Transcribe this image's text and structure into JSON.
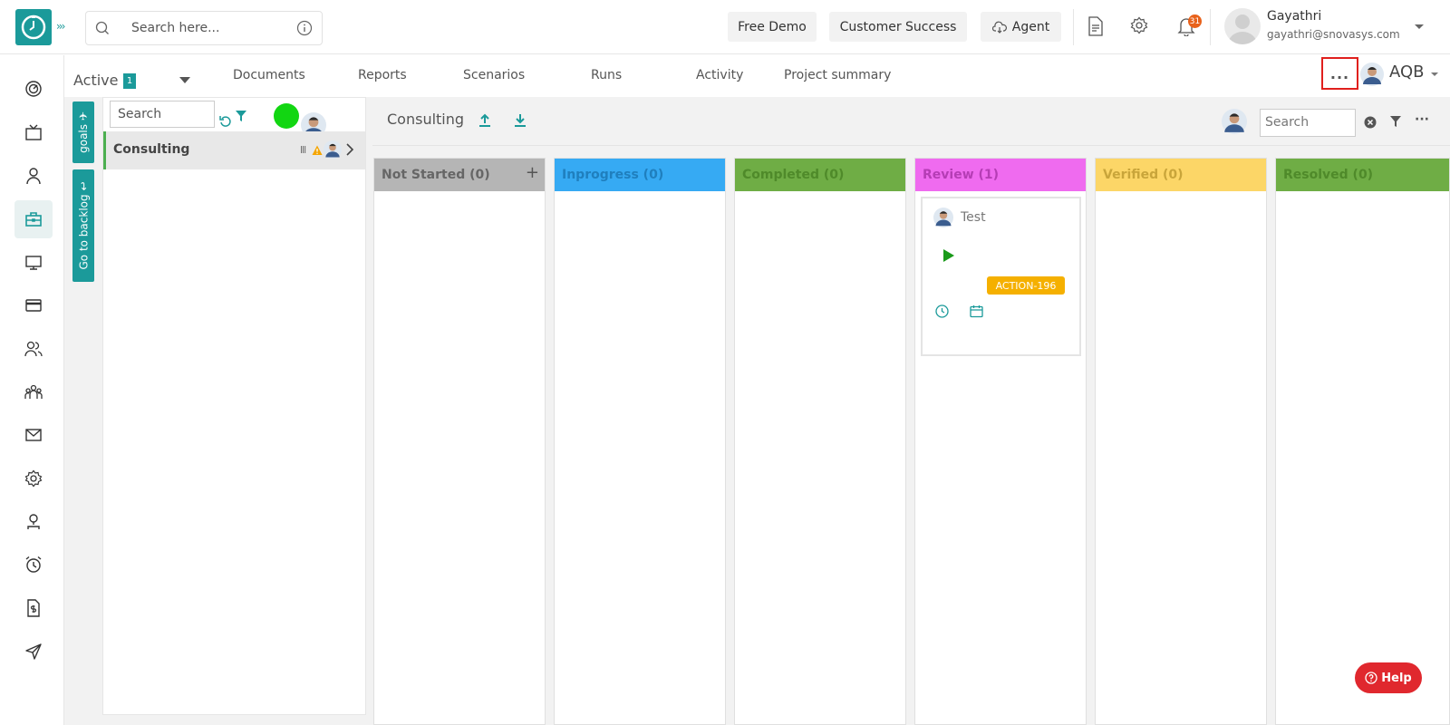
{
  "header": {
    "search_placeholder": "Search here...",
    "buttons": {
      "free_demo": "Free Demo",
      "customer_success": "Customer Success",
      "agent": "Agent"
    },
    "notification_count": "31",
    "user": {
      "name": "Gayathri",
      "email": "gayathri@snovasys.com"
    }
  },
  "sidebar": {
    "items": [
      {
        "icon": "dashboard-icon"
      },
      {
        "icon": "tv-icon"
      },
      {
        "icon": "user-icon"
      },
      {
        "icon": "briefcase-icon",
        "active": true
      },
      {
        "icon": "monitor-icon"
      },
      {
        "icon": "card-icon"
      },
      {
        "icon": "users-icon"
      },
      {
        "icon": "team-icon"
      },
      {
        "icon": "mail-icon"
      },
      {
        "icon": "settings-icon"
      },
      {
        "icon": "profile-icon"
      },
      {
        "icon": "alarm-icon"
      },
      {
        "icon": "invoice-icon"
      },
      {
        "icon": "send-icon"
      }
    ]
  },
  "subnav": {
    "status_label": "Active",
    "status_count": "1",
    "tabs": [
      "Documents",
      "Reports",
      "Scenarios",
      "Runs",
      "Activity",
      "Project summary"
    ],
    "more_label": "...",
    "project_code": "AQB"
  },
  "side_tabs": {
    "goals": "goals",
    "backlog": "Go to backlog"
  },
  "goals": {
    "search_placeholder": "Search",
    "items": [
      {
        "name": "Consulting"
      }
    ]
  },
  "board": {
    "title": "Consulting",
    "search_placeholder": "Search",
    "columns": [
      {
        "name": "Not Started (0)",
        "color": "#b5b5b5"
      },
      {
        "name": "Inprogress (0)",
        "color": "#36aaf3"
      },
      {
        "name": "Completed (0)",
        "color": "#6fad45"
      },
      {
        "name": "Review (1)",
        "color": "#ef6bef"
      },
      {
        "name": "Verified (0)",
        "color": "#fcd667"
      },
      {
        "name": "Resolved (0)",
        "color": "#6fad45"
      }
    ],
    "card": {
      "title": "Test",
      "badge": "ACTION-196"
    }
  },
  "help": {
    "label": "Help"
  },
  "colors": {
    "accent": "#1b9a9a",
    "highlight_red": "#e0201d"
  }
}
